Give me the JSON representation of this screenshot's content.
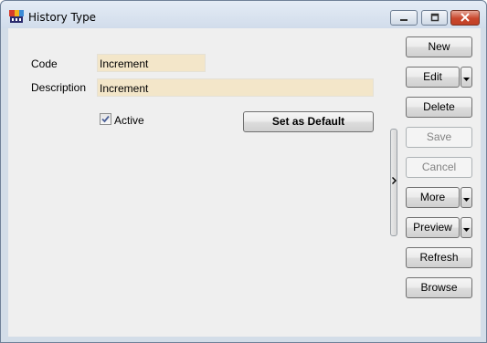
{
  "window": {
    "title": "History Type"
  },
  "form": {
    "code_label": "Code",
    "code_value": "Increment",
    "description_label": "Description",
    "description_value": "Increment",
    "active_label": "Active",
    "active_checked": true,
    "set_default_label": "Set as Default"
  },
  "buttons": {
    "new": "New",
    "edit": "Edit",
    "delete": "Delete",
    "save": "Save",
    "cancel": "Cancel",
    "more": "More",
    "preview": "Preview",
    "refresh": "Refresh",
    "browse": "Browse"
  },
  "icons": {
    "app": "app-logo-icon",
    "minimize": "minimize-icon",
    "maximize": "maximize-icon",
    "close": "close-icon",
    "dropdown": "chevron-down-icon",
    "splitter": "chevron-right-icon"
  }
}
